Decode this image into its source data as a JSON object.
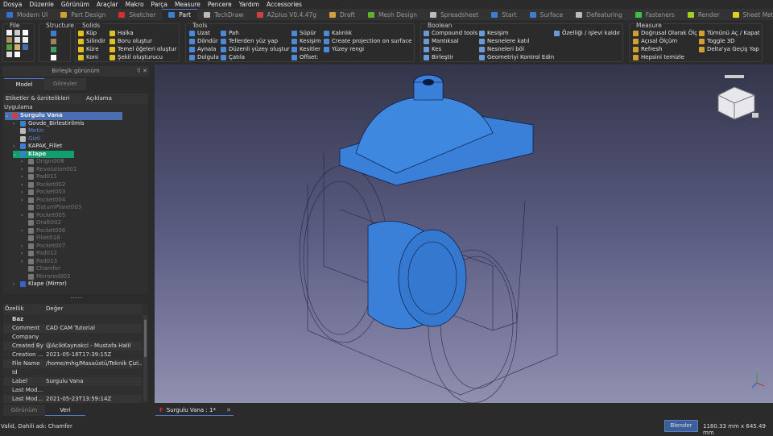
{
  "menu": [
    "Dosya",
    "Düzenle",
    "Görünüm",
    "Araçlar",
    "Makro",
    "Parça",
    "Measure",
    "Pencere",
    "Yardım",
    "Accessories"
  ],
  "workbenches": [
    {
      "label": "Modern UI",
      "color": "#3a6fd0"
    },
    {
      "label": "Part Design",
      "color": "#d0a030"
    },
    {
      "label": "Sketcher",
      "color": "#d03030"
    },
    {
      "label": "Part",
      "color": "#3a7fd0",
      "active": true
    },
    {
      "label": "TechDraw",
      "color": "#bbbbbb"
    },
    {
      "label": "A2plus V0.4.47g",
      "color": "#d04040"
    },
    {
      "label": "Draft",
      "color": "#d0a040"
    },
    {
      "label": "Mesh Design",
      "color": "#60b030"
    },
    {
      "label": "Spreadsheet",
      "color": "#bbbbbb"
    },
    {
      "label": "Start",
      "color": "#3a7fd0"
    },
    {
      "label": "Surface",
      "color": "#3a7fd0"
    },
    {
      "label": "Defeaturing",
      "color": "#bbbbbb"
    },
    {
      "label": "Fasteners",
      "color": "#40c040"
    },
    {
      "label": "Render",
      "color": "#a0d020"
    },
    {
      "label": "Sheet Metal V0.2.",
      "color": "#e0d020"
    }
  ],
  "toolbar": {
    "file_title": "File",
    "structure_title": "Structure",
    "solids": {
      "title": "Solids",
      "items": [
        "Küp",
        "Silindir",
        "Küre",
        "Koni",
        "Halka",
        "Boru oluştur",
        "Temel öğeleri oluştur",
        "Şekil oluşturucu"
      ]
    },
    "tools": {
      "title": "Tools",
      "items": [
        "Uzat",
        "Döndür",
        "Aynala",
        "Dolgula",
        "Pah",
        "Tellerden yüz yap",
        "Düzenli yüzey oluştur",
        "Çatıla",
        "Süpür",
        "Kesişim",
        "Kesitler",
        "Offset:",
        "Kalınlık",
        "Create projection on surface",
        "Yüzey rengi"
      ]
    },
    "boolean": {
      "title": "Boolean",
      "items": [
        "Compound tools",
        "Mantıksal",
        "Kes",
        "Birleştir",
        "Kesişim",
        "Nesnelere katıl",
        "Nesneleri böl",
        "Geometriyi Kontrol Edin",
        "Özelliği / işlevi kaldır"
      ]
    },
    "measure": {
      "title": "Measure",
      "items": [
        "Doğrusal Olarak Ölç",
        "Açısal Ölçüm",
        "Refresh",
        "Hepsini temizle",
        "Tümünü Aç / Kapat",
        "Toggle 3D",
        "Delta'ya Geçiş Yap"
      ]
    }
  },
  "panel": {
    "title": "Birleşik görünüm",
    "tabs": [
      "Model",
      "Görevler"
    ],
    "columns": [
      "Etiketler & öznitelikleri",
      "Açıklama"
    ],
    "root_label": "Uygulama"
  },
  "tree": [
    {
      "label": "Surgulu Vana",
      "level": 0,
      "state": "selected",
      "color": "#d04040"
    },
    {
      "label": "Govde_Birlestirilmis",
      "level": 1,
      "state": "normal",
      "color": "#3a7fd0"
    },
    {
      "label": "Metin",
      "level": 1,
      "state": "link",
      "color": "#bbbbbb"
    },
    {
      "label": "Gizli",
      "level": 1,
      "state": "link",
      "color": "#bbbbbb"
    },
    {
      "label": "KAPAK_Fillet",
      "level": 1,
      "state": "normal",
      "color": "#3a7fd0"
    },
    {
      "label": "Klape",
      "level": 1,
      "state": "active",
      "color": "#3a7fd0"
    },
    {
      "label": "Origin008",
      "level": 2,
      "state": "hidden",
      "color": "#777"
    },
    {
      "label": "Revolution001",
      "level": 2,
      "state": "hidden",
      "color": "#777"
    },
    {
      "label": "Pad011",
      "level": 2,
      "state": "hidden",
      "color": "#777"
    },
    {
      "label": "Pocket002",
      "level": 2,
      "state": "hidden",
      "color": "#777"
    },
    {
      "label": "Pocket003",
      "level": 2,
      "state": "hidden",
      "color": "#777"
    },
    {
      "label": "Pocket004",
      "level": 2,
      "state": "hidden",
      "color": "#777"
    },
    {
      "label": "DatumPlane003",
      "level": 2,
      "state": "hidden",
      "color": "#777"
    },
    {
      "label": "Pocket005",
      "level": 2,
      "state": "hidden",
      "color": "#777"
    },
    {
      "label": "Draft002",
      "level": 2,
      "state": "hidden",
      "color": "#777"
    },
    {
      "label": "Pocket006",
      "level": 2,
      "state": "hidden",
      "color": "#777"
    },
    {
      "label": "Fillet018",
      "level": 2,
      "state": "hidden",
      "color": "#777"
    },
    {
      "label": "Pocket007",
      "level": 2,
      "state": "hidden",
      "color": "#777"
    },
    {
      "label": "Pad012",
      "level": 2,
      "state": "hidden",
      "color": "#777"
    },
    {
      "label": "Pad013",
      "level": 2,
      "state": "hidden",
      "color": "#777"
    },
    {
      "label": "Chamfer",
      "level": 2,
      "state": "hidden",
      "color": "#777"
    },
    {
      "label": "Mirrored002",
      "level": 2,
      "state": "hidden",
      "color": "#777"
    },
    {
      "label": "Klape (Mirror)",
      "level": 1,
      "state": "normal",
      "color": "#3a5fd0"
    }
  ],
  "properties": {
    "columns": [
      "Özellik",
      "Değer"
    ],
    "group": "Baz",
    "rows": [
      {
        "k": "Comment",
        "v": "CAD CAM Tutorial"
      },
      {
        "k": "Company",
        "v": ""
      },
      {
        "k": "Created By",
        "v": "@AcikKaynakci - Mustafa Halil"
      },
      {
        "k": "Creation ...",
        "v": "2021-05-16T17:39:15Z"
      },
      {
        "k": "File Name",
        "v": "/home/mhg/Masaüstü/Teknik Çizi..."
      },
      {
        "k": "Id",
        "v": ""
      },
      {
        "k": "Label",
        "v": "Surgulu Vana"
      },
      {
        "k": "Last Mod...",
        "v": ""
      },
      {
        "k": "Last Mod...",
        "v": "2021-05-23T13:59:14Z"
      }
    ],
    "tabs": [
      "Görünüm",
      "Veri"
    ]
  },
  "document_tab": "Surgulu Vana : 1*",
  "status": {
    "message": "Valid, Dahili adı: Chamfer",
    "nav_style": "Blender",
    "dimensions": "1180.33 mm x 645.49 mm"
  },
  "colors": {
    "accent": "#4a7bd0",
    "selected": "#4a6fb0",
    "active": "#10a070",
    "model": "#3a7fd8"
  }
}
